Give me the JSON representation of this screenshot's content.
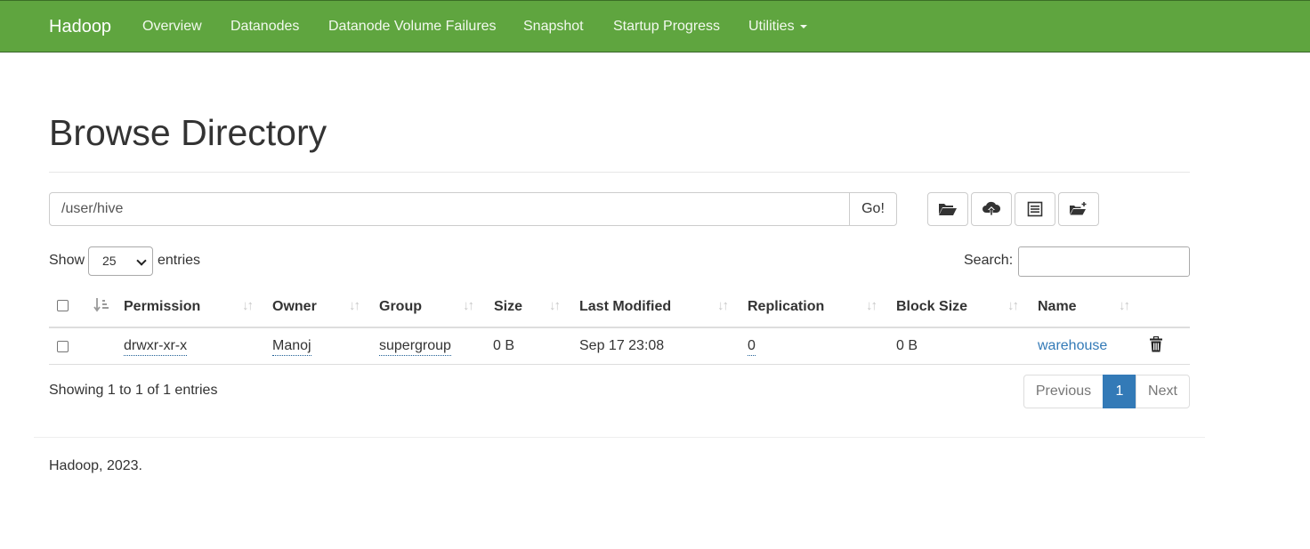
{
  "navbar": {
    "brand": "Hadoop",
    "items": [
      {
        "label": "Overview"
      },
      {
        "label": "Datanodes"
      },
      {
        "label": "Datanode Volume Failures"
      },
      {
        "label": "Snapshot"
      },
      {
        "label": "Startup Progress"
      },
      {
        "label": "Utilities"
      }
    ],
    "bg_color": "#5fa53f"
  },
  "page": {
    "title": "Browse Directory"
  },
  "path_bar": {
    "value": "/user/hive",
    "go_label": "Go!"
  },
  "toolbar": {
    "icons": [
      "folder-open-icon",
      "cloud-upload-icon",
      "list-icon",
      "create-directory-icon"
    ]
  },
  "length_menu": {
    "show_label": "Show",
    "selected": "25",
    "entries_label": "entries"
  },
  "search": {
    "label": "Search:",
    "value": ""
  },
  "table": {
    "columns": [
      "Permission",
      "Owner",
      "Group",
      "Size",
      "Last Modified",
      "Replication",
      "Block Size",
      "Name"
    ],
    "rows": [
      {
        "permission": "drwxr-xr-x",
        "owner": "Manoj",
        "group": "supergroup",
        "size": "0 B",
        "last_modified": "Sep 17 23:08",
        "replication": "0",
        "block_size": "0 B",
        "name": "warehouse"
      }
    ]
  },
  "info": {
    "text": "Showing 1 to 1 of 1 entries"
  },
  "pagination": {
    "previous": "Previous",
    "current": "1",
    "next": "Next",
    "active_color": "#337ab7"
  },
  "footer": {
    "text": "Hadoop, 2023."
  }
}
